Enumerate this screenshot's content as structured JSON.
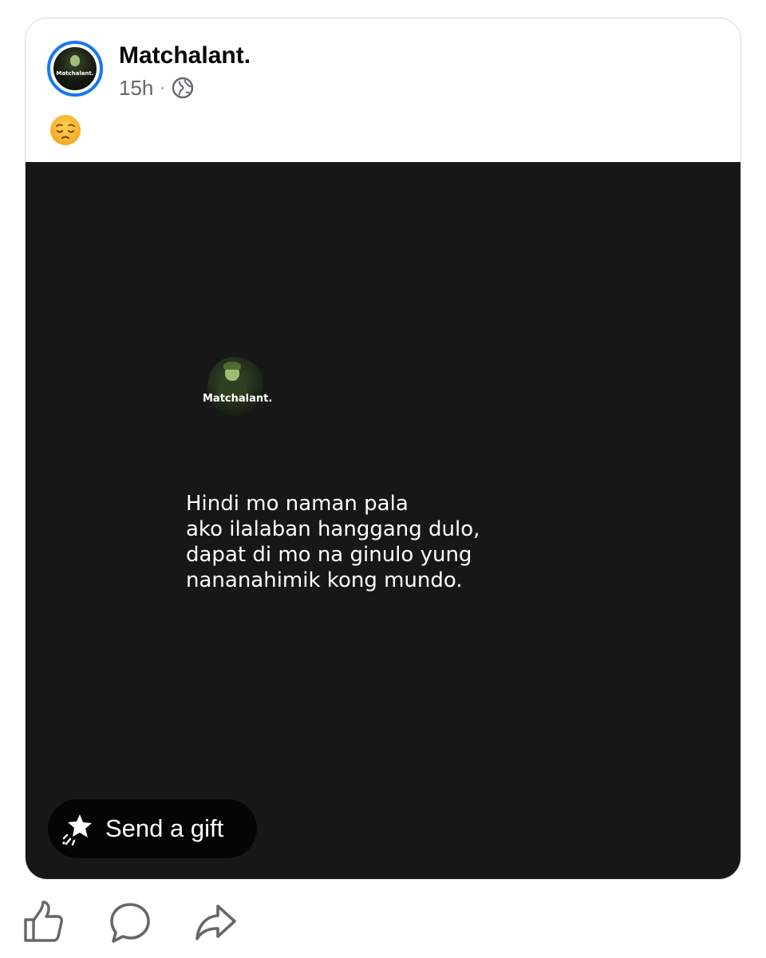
{
  "post": {
    "author": "Matchalant.",
    "avatar_text": "Matchalant.",
    "time": "15h",
    "separator": "·",
    "audience_icon": "globe-icon",
    "caption_emoji": "pensive-face-emoji"
  },
  "media": {
    "watermark_name": "Matchalant.",
    "quote_lines": [
      "Hindi mo naman pala",
      "ako ilalaban hanggang dulo,",
      "dapat di mo na ginulo yung",
      "nananahimik kong mundo."
    ],
    "gift_button": {
      "label": "Send a gift",
      "icon": "gift-star-icon"
    }
  },
  "actions": [
    {
      "name": "like",
      "icon": "thumbs-up-icon"
    },
    {
      "name": "comment",
      "icon": "comment-bubble-icon"
    },
    {
      "name": "share",
      "icon": "share-arrow-icon"
    }
  ],
  "colors": {
    "accent": "#1877f2",
    "media_background": "#171718",
    "text_secondary": "#65676b",
    "icon": "#65676b"
  }
}
